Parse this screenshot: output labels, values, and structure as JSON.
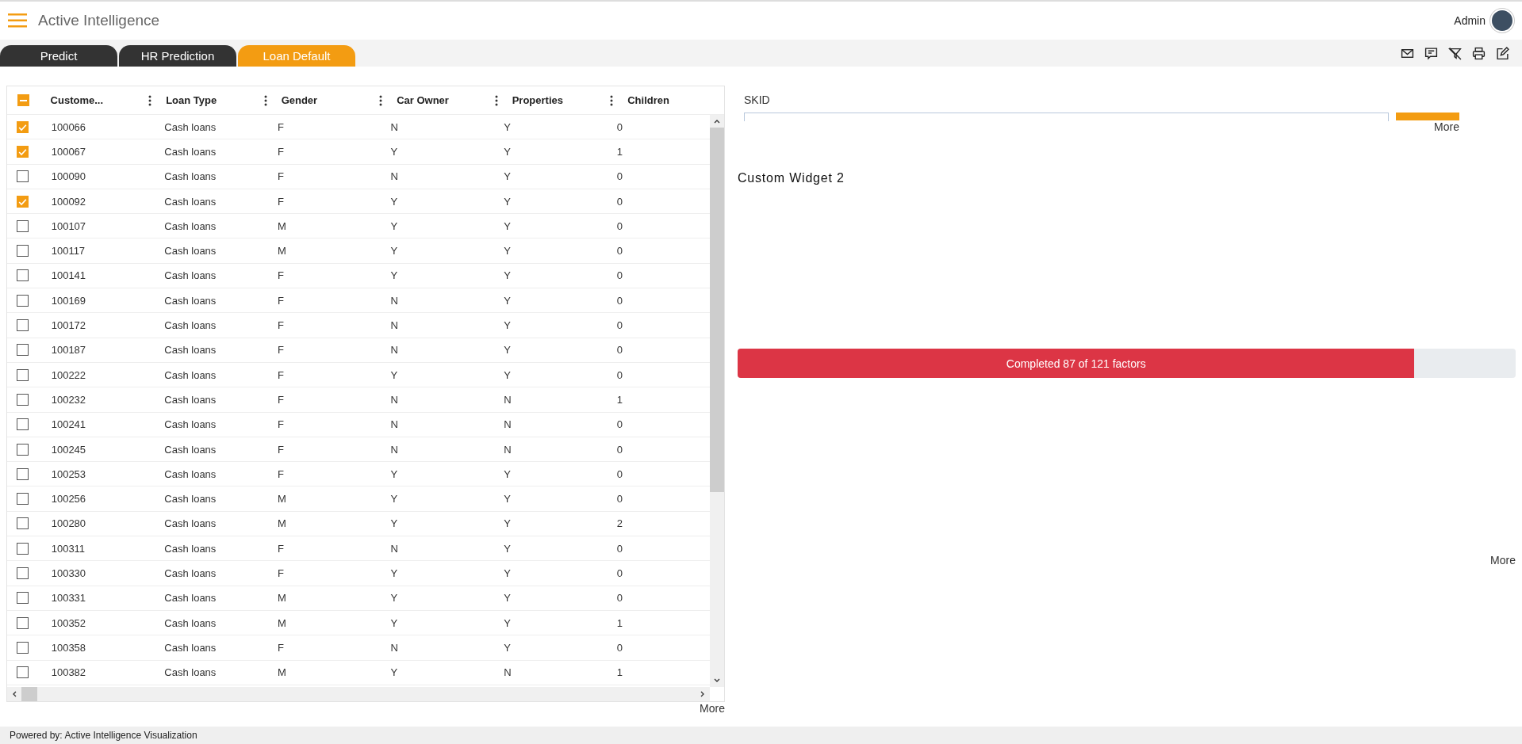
{
  "app": {
    "title": "Active Intelligence",
    "user": "Admin"
  },
  "tabs": [
    {
      "label": "Predict",
      "selected": false
    },
    {
      "label": "HR Prediction",
      "selected": false
    },
    {
      "label": "Loan Default",
      "selected": true
    }
  ],
  "table": {
    "select_all": {
      "indeterminate": true
    },
    "columns": [
      "Custome...",
      "Loan Type",
      "Gender",
      "Car Owner",
      "Properties",
      "Children"
    ],
    "rows": [
      {
        "checked": true,
        "cells": [
          "100066",
          "Cash loans",
          "F",
          "N",
          "Y",
          "0"
        ]
      },
      {
        "checked": true,
        "cells": [
          "100067",
          "Cash loans",
          "F",
          "Y",
          "Y",
          "1"
        ]
      },
      {
        "checked": false,
        "cells": [
          "100090",
          "Cash loans",
          "F",
          "N",
          "Y",
          "0"
        ]
      },
      {
        "checked": true,
        "cells": [
          "100092",
          "Cash loans",
          "F",
          "Y",
          "Y",
          "0"
        ]
      },
      {
        "checked": false,
        "cells": [
          "100107",
          "Cash loans",
          "M",
          "Y",
          "Y",
          "0"
        ]
      },
      {
        "checked": false,
        "cells": [
          "100117",
          "Cash loans",
          "M",
          "Y",
          "Y",
          "0"
        ]
      },
      {
        "checked": false,
        "cells": [
          "100141",
          "Cash loans",
          "F",
          "Y",
          "Y",
          "0"
        ]
      },
      {
        "checked": false,
        "cells": [
          "100169",
          "Cash loans",
          "F",
          "N",
          "Y",
          "0"
        ]
      },
      {
        "checked": false,
        "cells": [
          "100172",
          "Cash loans",
          "F",
          "N",
          "Y",
          "0"
        ]
      },
      {
        "checked": false,
        "cells": [
          "100187",
          "Cash loans",
          "F",
          "N",
          "Y",
          "0"
        ]
      },
      {
        "checked": false,
        "cells": [
          "100222",
          "Cash loans",
          "F",
          "Y",
          "Y",
          "0"
        ]
      },
      {
        "checked": false,
        "cells": [
          "100232",
          "Cash loans",
          "F",
          "N",
          "N",
          "1"
        ]
      },
      {
        "checked": false,
        "cells": [
          "100241",
          "Cash loans",
          "F",
          "N",
          "N",
          "0"
        ]
      },
      {
        "checked": false,
        "cells": [
          "100245",
          "Cash loans",
          "F",
          "N",
          "N",
          "0"
        ]
      },
      {
        "checked": false,
        "cells": [
          "100253",
          "Cash loans",
          "F",
          "Y",
          "Y",
          "0"
        ]
      },
      {
        "checked": false,
        "cells": [
          "100256",
          "Cash loans",
          "M",
          "Y",
          "Y",
          "0"
        ]
      },
      {
        "checked": false,
        "cells": [
          "100280",
          "Cash loans",
          "M",
          "Y",
          "Y",
          "2"
        ]
      },
      {
        "checked": false,
        "cells": [
          "100311",
          "Cash loans",
          "F",
          "N",
          "Y",
          "0"
        ]
      },
      {
        "checked": false,
        "cells": [
          "100330",
          "Cash loans",
          "F",
          "Y",
          "Y",
          "0"
        ]
      },
      {
        "checked": false,
        "cells": [
          "100331",
          "Cash loans",
          "M",
          "Y",
          "Y",
          "0"
        ]
      },
      {
        "checked": false,
        "cells": [
          "100352",
          "Cash loans",
          "M",
          "Y",
          "Y",
          "1"
        ]
      },
      {
        "checked": false,
        "cells": [
          "100358",
          "Cash loans",
          "F",
          "N",
          "Y",
          "0"
        ]
      },
      {
        "checked": false,
        "cells": [
          "100382",
          "Cash loans",
          "M",
          "Y",
          "N",
          "1"
        ]
      }
    ],
    "more": "More"
  },
  "skid_filter": {
    "label": "SKID",
    "more": "More"
  },
  "custom_widget": {
    "title": "Custom Widget 2",
    "progress": {
      "label": "Completed 87 of 121 factors",
      "level": 0.87
    },
    "more": "More"
  },
  "footer": "Powered by: Active Intelligence Visualization"
}
